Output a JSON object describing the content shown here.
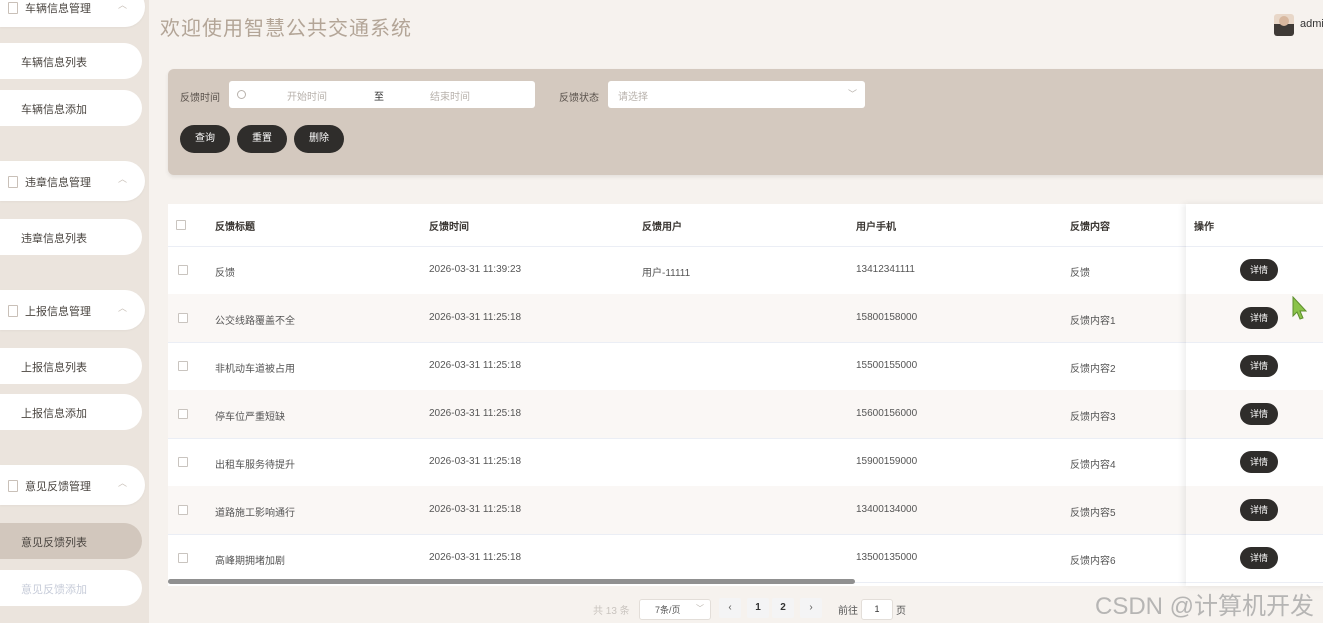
{
  "app": {
    "title": "欢迎使用智慧公共交通系统",
    "user": "admin"
  },
  "sidebar": {
    "groups": [
      {
        "title": "车辆信息管理",
        "items": [
          "车辆信息列表",
          "车辆信息添加"
        ]
      },
      {
        "title": "违章信息管理",
        "items": [
          "违章信息列表"
        ]
      },
      {
        "title": "上报信息管理",
        "items": [
          "上报信息列表",
          "上报信息添加"
        ]
      },
      {
        "title": "意见反馈管理",
        "items": [
          "意见反馈列表",
          "意见反馈添加"
        ],
        "active_item": "意见反馈列表"
      }
    ]
  },
  "search": {
    "time_label": "反馈时间",
    "start_placeholder": "开始时间",
    "range_separator": "至",
    "end_placeholder": "结束时间",
    "status_label": "反馈状态",
    "status_placeholder": "请选择",
    "buttons": {
      "query": "查询",
      "reset": "重置",
      "delete": "删除"
    }
  },
  "table": {
    "columns": [
      "反馈标题",
      "反馈时间",
      "反馈用户",
      "用户手机",
      "反馈内容",
      "操作"
    ],
    "detail_label": "详情",
    "rows": [
      {
        "title": "反馈",
        "time": "2026-03-31 11:39:23",
        "user": "用户-11111",
        "phone": "13412341111",
        "content": "反馈"
      },
      {
        "title": "公交线路覆盖不全",
        "time": "2026-03-31 11:25:18",
        "user": "",
        "phone": "15800158000",
        "content": "反馈内容1"
      },
      {
        "title": "非机动车道被占用",
        "time": "2026-03-31 11:25:18",
        "user": "",
        "phone": "15500155000",
        "content": "反馈内容2"
      },
      {
        "title": "停车位严重短缺",
        "time": "2026-03-31 11:25:18",
        "user": "",
        "phone": "15600156000",
        "content": "反馈内容3"
      },
      {
        "title": "出租车服务待提升",
        "time": "2026-03-31 11:25:18",
        "user": "",
        "phone": "15900159000",
        "content": "反馈内容4"
      },
      {
        "title": "道路施工影响通行",
        "time": "2026-03-31 11:25:18",
        "user": "",
        "phone": "13400134000",
        "content": "反馈内容5"
      },
      {
        "title": "高峰期拥堵加剧",
        "time": "2026-03-31 11:25:18",
        "user": "",
        "phone": "13500135000",
        "content": "反馈内容6"
      }
    ]
  },
  "pagination": {
    "total_text": "共 13 条",
    "page_size": "7条/页",
    "pages": [
      "1",
      "2"
    ],
    "current_page": "1",
    "goto_label": "前往",
    "goto_value": "1",
    "goto_unit": "页"
  },
  "watermark": "CSDN @计算机开发",
  "colors": {
    "sidebar_bg": "#ebe4dd",
    "panel_bg": "#d4c9bf",
    "button_bg": "#2f2d2b",
    "active_menu": "#d2c7bd",
    "cursor": "#8bc34a"
  }
}
